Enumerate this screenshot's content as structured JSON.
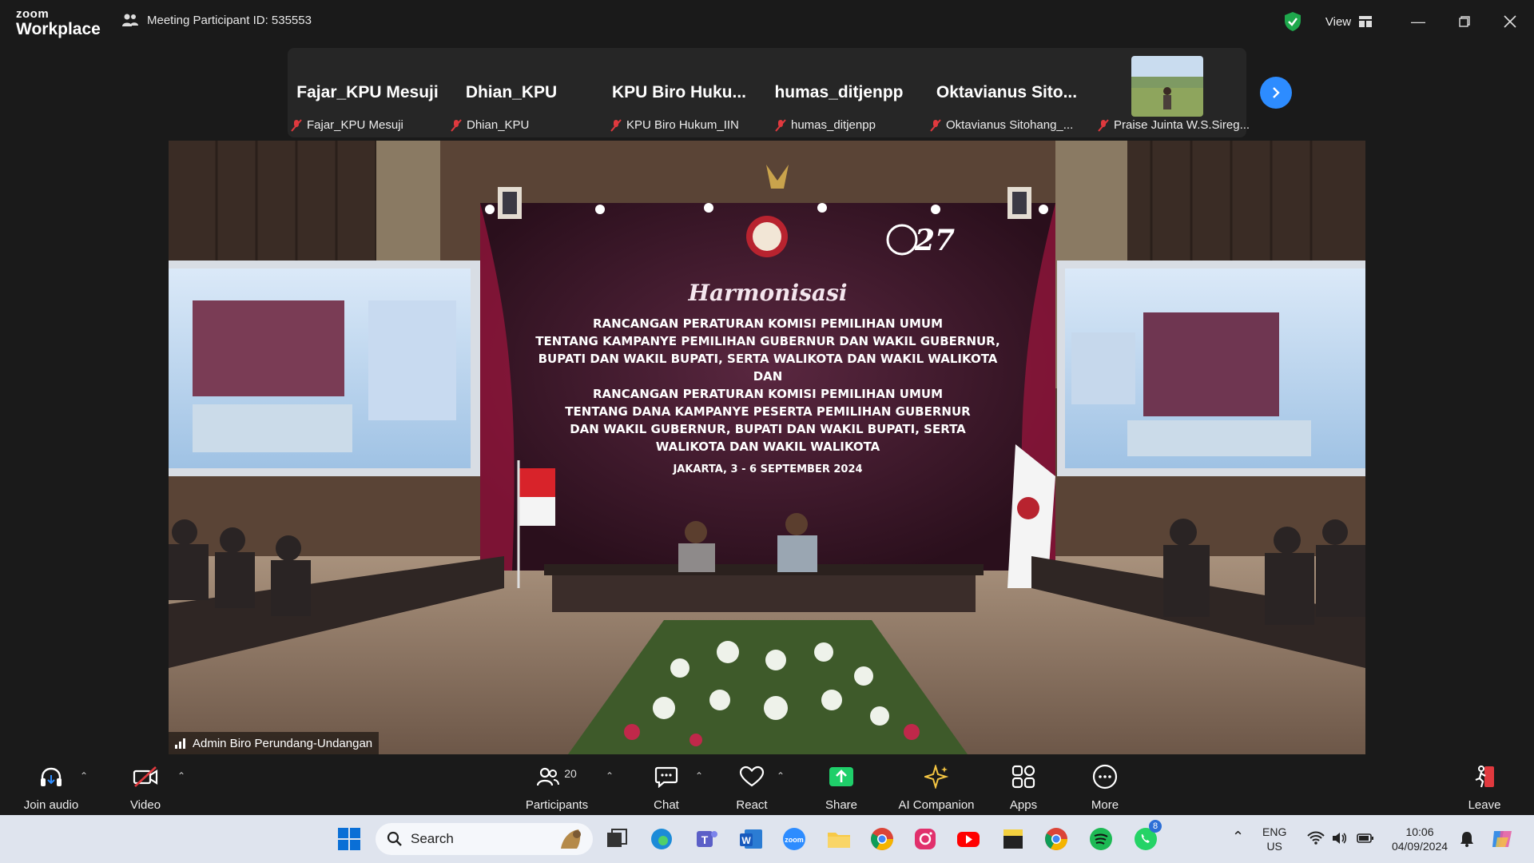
{
  "titlebar": {
    "brand_top": "zoom",
    "brand_bottom": "Workplace",
    "meeting_id": "Meeting Participant ID: 535553",
    "view_label": "View"
  },
  "participants_strip": {
    "tiles": [
      {
        "big": "Fajar_KPU Mesuji",
        "small": "Fajar_KPU Mesuji"
      },
      {
        "big": "Dhian_KPU",
        "small": "Dhian_KPU"
      },
      {
        "big": "KPU Biro Huku...",
        "small": "KPU Biro Hukum_IIN"
      },
      {
        "big": "humas_ditjenpp",
        "small": "humas_ditjenpp"
      },
      {
        "big": "Oktavianus Sito...",
        "small": "Oktavianus Sitohang_..."
      },
      {
        "big": "",
        "small": "Praise Juinta W.S.Sireg..."
      }
    ]
  },
  "video": {
    "speaker": "Admin Biro Perundang-Undangan",
    "banner": {
      "anniv": "27",
      "script_title": "Harmonisasi",
      "lines": [
        "RANCANGAN PERATURAN KOMISI PEMILIHAN UMUM",
        "TENTANG KAMPANYE PEMILIHAN GUBERNUR DAN WAKIL GUBERNUR,",
        "BUPATI DAN WAKIL BUPATI, SERTA WALIKOTA DAN WAKIL WALIKOTA",
        "DAN",
        "RANCANGAN PERATURAN KOMISI PEMILIHAN UMUM",
        "TENTANG DANA KAMPANYE PESERTA PEMILIHAN GUBERNUR",
        "DAN WAKIL GUBERNUR, BUPATI DAN WAKIL BUPATI, SERTA",
        "WALIKOTA DAN WAKIL WALIKOTA"
      ],
      "date": "JAKARTA, 3 - 6 SEPTEMBER 2024"
    }
  },
  "toolbar": {
    "join_audio": "Join audio",
    "video": "Video",
    "participants": "Participants",
    "participants_count": "20",
    "chat": "Chat",
    "react": "React",
    "share": "Share",
    "ai_companion": "AI Companion",
    "apps": "Apps",
    "more": "More",
    "leave": "Leave"
  },
  "taskbar": {
    "search_placeholder": "Search",
    "lang_top": "ENG",
    "lang_bottom": "US",
    "time": "10:06",
    "date": "04/09/2024",
    "whatsapp_badge": "8"
  },
  "colors": {
    "accent": "#2d8cff",
    "share": "#1fcf6a",
    "danger": "#e0393e",
    "shield": "#1ea84c"
  }
}
